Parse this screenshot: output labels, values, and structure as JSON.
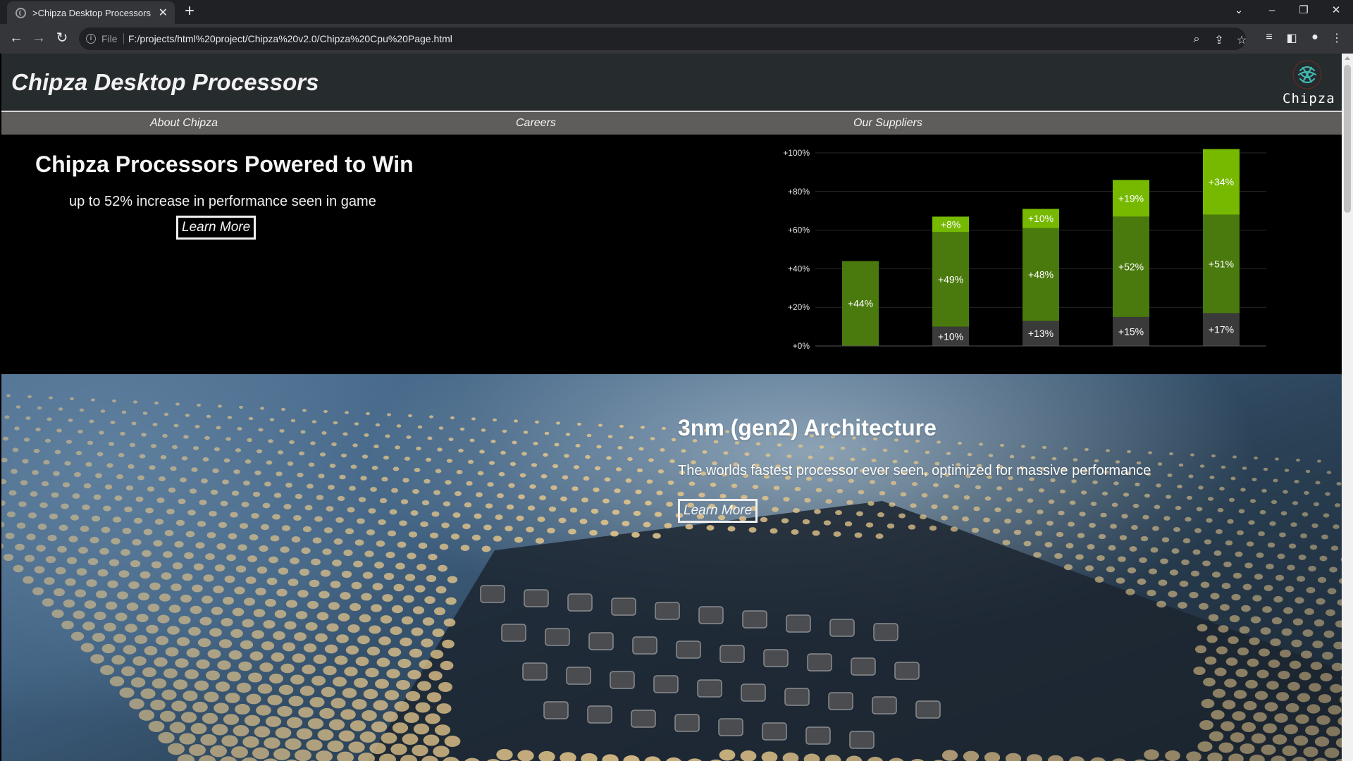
{
  "browser": {
    "tab_title": ">Chipza Desktop Processors",
    "url_scheme": "File",
    "url": "F:/projects/html%20project/Chipza%20v2.0/Chipza%20Cpu%20Page.html"
  },
  "site": {
    "title": "Chipza Desktop Processors",
    "logo_text": "Chipza",
    "nav": [
      "About Chipza",
      "Careers",
      "Our Suppliers"
    ]
  },
  "hero": {
    "title": "Chipza Processors Powered to Win",
    "subtitle": "up to 52% increase in performance seen in game",
    "button": "Learn More"
  },
  "chart_data": {
    "type": "bar",
    "stacked": true,
    "ylim": [
      0,
      100
    ],
    "yticks": [
      "+0%",
      "+20%",
      "+40%",
      "+60%",
      "+80%",
      "+100%"
    ],
    "grid": true,
    "colors": {
      "base": "#3a3a3a",
      "mid": "#4a7a0e",
      "top": "#76b900"
    },
    "bars": [
      {
        "segments": [
          {
            "layer": "mid",
            "value": 44,
            "label": "+44%"
          }
        ]
      },
      {
        "segments": [
          {
            "layer": "base",
            "value": 10,
            "label": "+10%"
          },
          {
            "layer": "mid",
            "value": 49,
            "label": "+49%"
          },
          {
            "layer": "top",
            "value": 8,
            "label": "+8%"
          }
        ]
      },
      {
        "segments": [
          {
            "layer": "base",
            "value": 13,
            "label": "+13%"
          },
          {
            "layer": "mid",
            "value": 48,
            "label": "+48%"
          },
          {
            "layer": "top",
            "value": 10,
            "label": "+10%"
          }
        ]
      },
      {
        "segments": [
          {
            "layer": "base",
            "value": 15,
            "label": "+15%"
          },
          {
            "layer": "mid",
            "value": 52,
            "label": "+52%"
          },
          {
            "layer": "top",
            "value": 19,
            "label": "+19%"
          }
        ]
      },
      {
        "segments": [
          {
            "layer": "base",
            "value": 17,
            "label": "+17%"
          },
          {
            "layer": "mid",
            "value": 51,
            "label": "+51%"
          },
          {
            "layer": "top",
            "value": 34,
            "label": "+34%"
          }
        ]
      }
    ]
  },
  "architecture": {
    "title": "3nm (gen2) Architecture",
    "subtitle": "The worlds fastest processor ever seen, optimized for massive performance",
    "button": "Learn More"
  }
}
